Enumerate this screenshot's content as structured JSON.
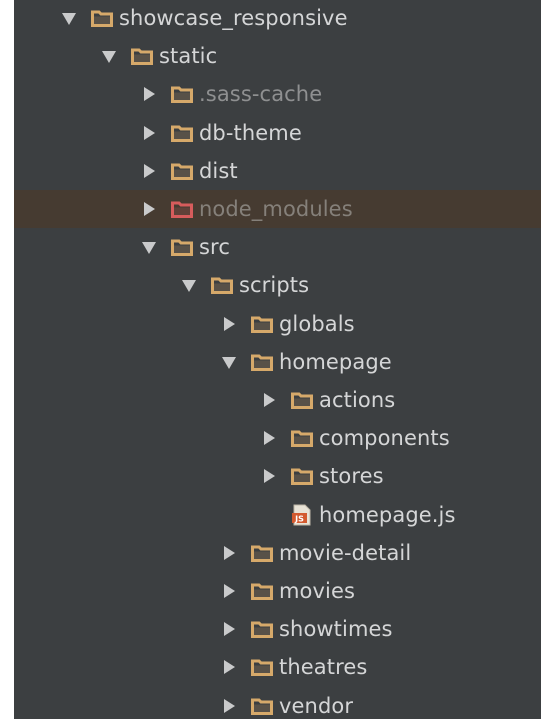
{
  "colors": {
    "panel_bg": "#3c3f41",
    "selected_row_bg": "#463b31",
    "text": "#d5d6d7",
    "text_dim": "#8f9091",
    "folder": "#d6a96a",
    "folder_excluded": "#d65c5c",
    "js_file": "#d35a2f"
  },
  "tree": [
    {
      "label": "showcase_responsive",
      "type": "folder",
      "expanded": true,
      "depth": 0
    },
    {
      "label": "static",
      "type": "folder",
      "expanded": true,
      "depth": 1
    },
    {
      "label": ".sass-cache",
      "type": "folder",
      "expanded": false,
      "depth": 2,
      "style": "dim"
    },
    {
      "label": "db-theme",
      "type": "folder",
      "expanded": false,
      "depth": 2
    },
    {
      "label": "dist",
      "type": "folder",
      "expanded": false,
      "depth": 2
    },
    {
      "label": "node_modules",
      "type": "folder-excluded",
      "expanded": false,
      "depth": 2,
      "style": "excluded",
      "selected": true
    },
    {
      "label": "src",
      "type": "folder",
      "expanded": true,
      "depth": 2
    },
    {
      "label": "scripts",
      "type": "folder",
      "expanded": true,
      "depth": 3
    },
    {
      "label": "globals",
      "type": "folder",
      "expanded": false,
      "depth": 4
    },
    {
      "label": "homepage",
      "type": "folder",
      "expanded": true,
      "depth": 4
    },
    {
      "label": "actions",
      "type": "folder",
      "expanded": false,
      "depth": 5
    },
    {
      "label": "components",
      "type": "folder",
      "expanded": false,
      "depth": 5
    },
    {
      "label": "stores",
      "type": "folder",
      "expanded": false,
      "depth": 5
    },
    {
      "label": "homepage.js",
      "type": "js-file",
      "depth": 5
    },
    {
      "label": "movie-detail",
      "type": "folder",
      "expanded": false,
      "depth": 4
    },
    {
      "label": "movies",
      "type": "folder",
      "expanded": false,
      "depth": 4
    },
    {
      "label": "showtimes",
      "type": "folder",
      "expanded": false,
      "depth": 4
    },
    {
      "label": "theatres",
      "type": "folder",
      "expanded": false,
      "depth": 4
    },
    {
      "label": "vendor",
      "type": "folder",
      "expanded": false,
      "depth": 4
    }
  ]
}
